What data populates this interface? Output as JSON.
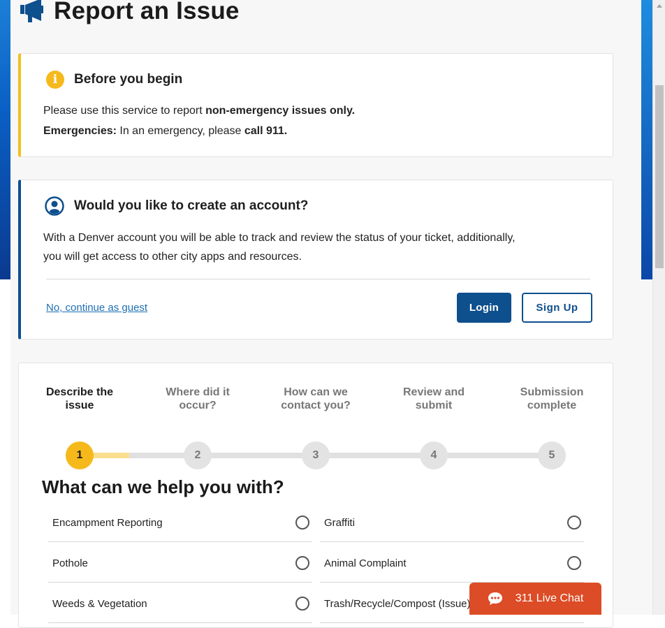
{
  "header": {
    "title": "Report an Issue",
    "icon": "megaphone-icon"
  },
  "notice": {
    "icon": "info-icon",
    "heading": "Before you begin",
    "line1_pre": "Please use this service to report ",
    "line1_bold": "non-emergency issues only.",
    "line2_bold": "Emergencies:",
    "line2_mid": " In an emergency, please ",
    "line2_end": "call 911."
  },
  "account": {
    "icon": "user-circle-icon",
    "heading": "Would you like to create an account?",
    "body_line1": "With a Denver account you will be able to track and review the status of your ticket, additionally,",
    "body_line2": "you will get access to other city apps and resources.",
    "guest_link": "No, continue as guest",
    "login_label": "Login",
    "signup_label": "Sign Up"
  },
  "steps": [
    {
      "number": "1",
      "label_line1": "Describe the",
      "label_line2": "issue"
    },
    {
      "number": "2",
      "label_line1": "Where did it",
      "label_line2": "occur?"
    },
    {
      "number": "3",
      "label_line1": "How can we",
      "label_line2": "contact you?"
    },
    {
      "number": "4",
      "label_line1": "Review and",
      "label_line2": "submit"
    },
    {
      "number": "5",
      "label_line1": "Submission",
      "label_line2": "complete"
    }
  ],
  "help": {
    "title": "What can we help you with?",
    "options": [
      "Encampment Reporting",
      "Graffiti",
      "Pothole",
      "Animal Complaint",
      "Weeds & Vegetation",
      "Trash/Recycle/Compost (Issue)"
    ]
  },
  "chat": {
    "label": "311 Live Chat",
    "color": "#dc4c26"
  },
  "colors": {
    "brand_blue": "#0e4f8d",
    "accent_yellow": "#f6b91c"
  }
}
